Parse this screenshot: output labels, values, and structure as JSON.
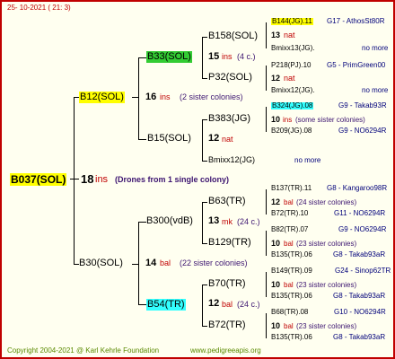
{
  "header": {
    "date": "25- 10-2021 ( 21: 3)"
  },
  "footer": {
    "copyright": "Copyright 2004-2021 @ Karl Kehrle Foundation",
    "site": "www.pedigreeapis.org"
  },
  "colors": {
    "border": "#c00000",
    "background": "#fffff0",
    "queen_bg_yellow": "#ffff00",
    "queen_bg_green": "#33cc33",
    "queen_bg_cyan": "#33ffff",
    "text_magenta": "#c00000",
    "text_blue": "#00007a"
  },
  "root": {
    "name": "B037(SOL)",
    "num": "18",
    "ins": "ins",
    "note": "(Drones from 1 single colony)"
  },
  "gen1": [
    {
      "name": "B12(SOL)",
      "num": "16",
      "ins": "ins",
      "note": "(2 sister colonies)"
    },
    {
      "name": "B30(SOL)",
      "num": "14",
      "ins": "bal",
      "note": "(22 sister colonies)"
    }
  ],
  "gen2": [
    {
      "name": "B33(SOL)",
      "num": "15",
      "ins": "ins",
      "note": "(4 c.)"
    },
    {
      "name": "B15(SOL)",
      "num": "12",
      "ins": "nat",
      "note": ""
    },
    {
      "name": "B300(vdB)",
      "num": "13",
      "ins": "mk",
      "note": "(24 c.)"
    },
    {
      "name": "B54(TR)",
      "num": "12",
      "ins": "bal",
      "note": "(24 c.)"
    }
  ],
  "gen3": [
    {
      "name": "B158(SOL)",
      "num": "13",
      "ins": "nat"
    },
    {
      "name": "P32(SOL)",
      "num": "12",
      "ins": "nat"
    },
    {
      "name": "B383(JG)",
      "num": "10",
      "ins": "ins",
      "note": "(some sister colonies)"
    },
    {
      "name": "Bmixx12(JG)",
      "note": "no more"
    },
    {
      "name": "B63(TR)",
      "num": "12",
      "ins": "bal",
      "note": "(24 sister colonies)"
    },
    {
      "name": "B129(TR)",
      "num": "10",
      "ins": "bal",
      "note": "(23 sister colonies)"
    },
    {
      "name": "B70(TR)",
      "num": "10",
      "ins": "bal",
      "note": "(23 sister colonies)"
    },
    {
      "name": "B72(TR)",
      "num": "10",
      "ins": "bal",
      "note": "(23 sister colonies)"
    }
  ],
  "gen4": [
    {
      "name": "B144(JG).11",
      "breeder": "G17 - AthosSt80R"
    },
    {
      "name": "Bmixx13(JG).",
      "breeder": "no more"
    },
    {
      "name": "P218(PJ).10",
      "breeder": "G5 - PrimGreen00"
    },
    {
      "name": "Bmixx12(JG).",
      "breeder": "no more"
    },
    {
      "name": "B324(JG).08",
      "breeder": "G9 - Takab93R"
    },
    {
      "name": "B209(JG).08",
      "breeder": "G9 - NO6294R"
    },
    {
      "name": "B137(TR).11",
      "breeder": "G8 - Kangaroo98R"
    },
    {
      "name": "B72(TR).10",
      "breeder": "G11 - NO6294R"
    },
    {
      "name": "B82(TR).07",
      "breeder": "G9 - NO6294R"
    },
    {
      "name": "B135(TR).06",
      "breeder": "G8 - Takab93aR"
    },
    {
      "name": "B149(TR).09",
      "breeder": "G24 - Sinop62TR"
    },
    {
      "name": "B135(TR).06",
      "breeder": "G8 - Takab93aR"
    },
    {
      "name": "B68(TR).08",
      "breeder": "G10 - NO6294R"
    },
    {
      "name": "B135(TR).06",
      "breeder": "G8 - Takab93aR"
    }
  ]
}
